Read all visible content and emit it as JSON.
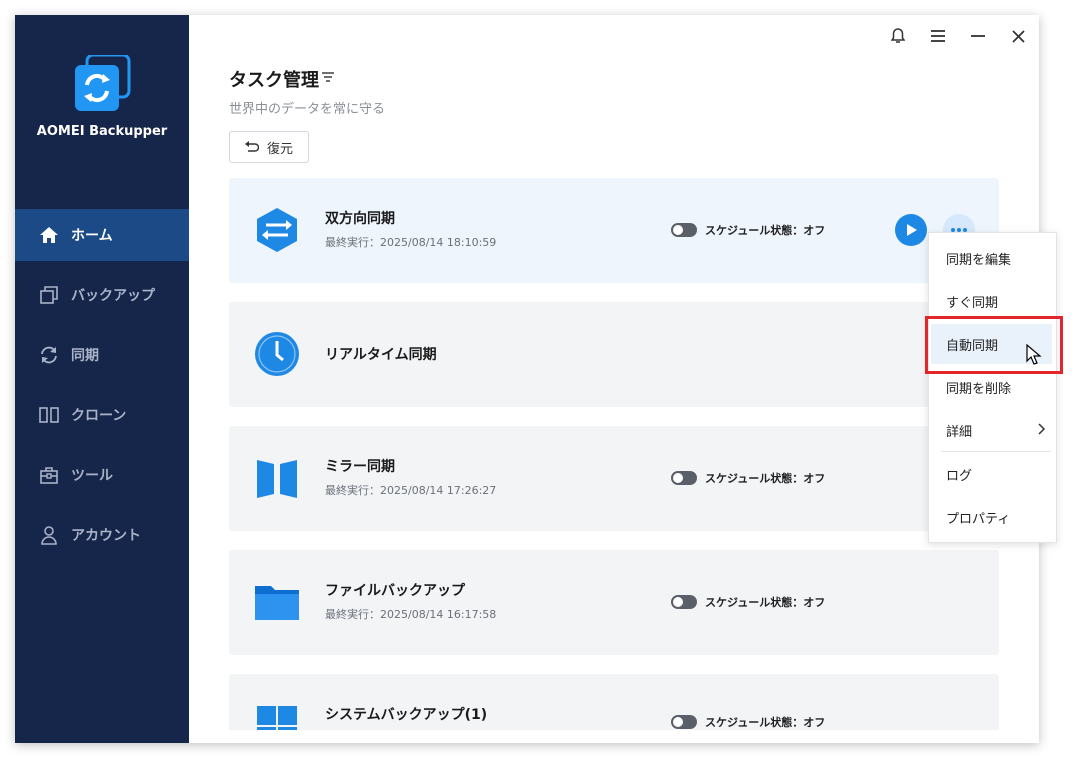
{
  "app": {
    "name": "AOMEI Backupper",
    "accent_color": "#1e88e5",
    "sidebar_color": "#16254a"
  },
  "titlebar": {
    "icons": [
      "bell-icon",
      "menu-icon",
      "minimize-icon",
      "close-icon"
    ]
  },
  "sidebar": {
    "items": [
      {
        "label": "ホーム",
        "icon": "home-icon",
        "active": true
      },
      {
        "label": "バックアップ",
        "icon": "backup-icon",
        "active": false
      },
      {
        "label": "同期",
        "icon": "sync-icon",
        "active": false
      },
      {
        "label": "クローン",
        "icon": "clone-icon",
        "active": false
      },
      {
        "label": "ツール",
        "icon": "toolbox-icon",
        "active": false
      },
      {
        "label": "アカウント",
        "icon": "user-icon",
        "active": false
      }
    ]
  },
  "main": {
    "title": "タスク管理",
    "subtitle": "世界中のデータを常に守る",
    "restore_label": "復元",
    "tasks": [
      {
        "name": "双方向同期",
        "meta": "最終実行：2025/08/14 18:10:59",
        "schedule": "スケジュール状態：オフ",
        "icon": "two-way-sync-icon"
      },
      {
        "name": "リアルタイム同期",
        "meta": "",
        "schedule": "",
        "icon": "clock-icon"
      },
      {
        "name": "ミラー同期",
        "meta": "最終実行：2025/08/14 17:26:27",
        "schedule": "スケジュール状態：オフ",
        "icon": "mirror-sync-icon"
      },
      {
        "name": "ファイルバックアップ",
        "meta": "最終実行：2025/08/14 16:17:58",
        "schedule": "スケジュール状態：オフ",
        "icon": "folder-icon"
      },
      {
        "name": "システムバックアップ(1)",
        "meta": "",
        "schedule": "スケジュール状態：オフ",
        "icon": "windows-icon"
      }
    ]
  },
  "context_menu": {
    "items": [
      "同期を編集",
      "すぐ同期",
      "自動同期",
      "同期を削除",
      "詳細",
      "ログ",
      "プロパティ"
    ],
    "hovered": "自動同期"
  }
}
